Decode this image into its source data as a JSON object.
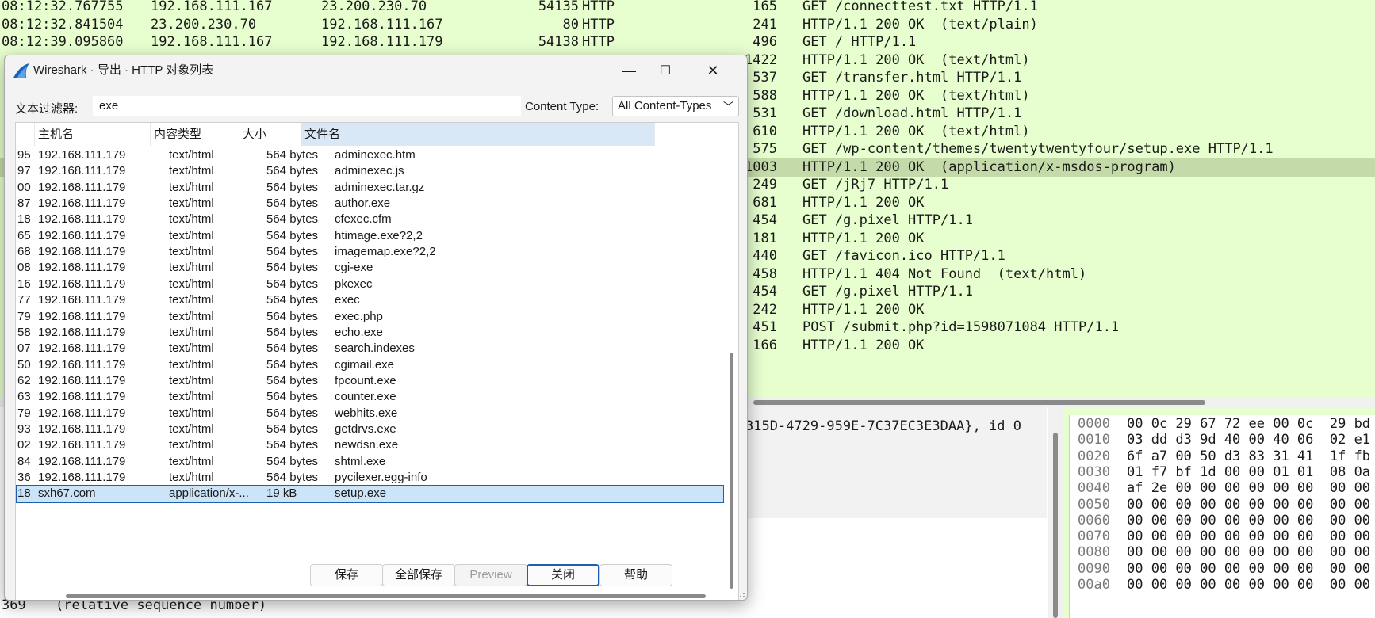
{
  "main_window": {
    "packets": [
      {
        "time": "08:12:32.767755",
        "src": "192.168.111.167",
        "dst": "23.200.230.70",
        "sport": "54135",
        "proto": "HTTP",
        "len": "165",
        "info": "GET /connecttest.txt HTTP/1.1"
      },
      {
        "time": "08:12:32.841504",
        "src": "23.200.230.70",
        "dst": "192.168.111.167",
        "sport": "80",
        "proto": "HTTP",
        "len": "241",
        "info": "HTTP/1.1 200 OK  (text/plain)"
      },
      {
        "time": "08:12:39.095860",
        "src": "192.168.111.167",
        "dst": "192.168.111.179",
        "sport": "54138",
        "proto": "HTTP",
        "len": "496",
        "info": "GET / HTTP/1.1"
      },
      {
        "time": "",
        "src": "",
        "dst": "",
        "sport": "",
        "proto": "",
        "len": "1422",
        "info": "HTTP/1.1 200 OK  (text/html)"
      },
      {
        "time": "",
        "src": "",
        "dst": "",
        "sport": "",
        "proto": "",
        "len": "537",
        "info": "GET /transfer.html HTTP/1.1"
      },
      {
        "time": "",
        "src": "",
        "dst": "",
        "sport": "",
        "proto": "",
        "len": "588",
        "info": "HTTP/1.1 200 OK  (text/html)"
      },
      {
        "time": "",
        "src": "",
        "dst": "",
        "sport": "",
        "proto": "",
        "len": "531",
        "info": "GET /download.html HTTP/1.1"
      },
      {
        "time": "",
        "src": "",
        "dst": "",
        "sport": "",
        "proto": "",
        "len": "610",
        "info": "HTTP/1.1 200 OK  (text/html)"
      },
      {
        "time": "",
        "src": "",
        "dst": "",
        "sport": "",
        "proto": "",
        "len": "575",
        "info": "GET /wp-content/themes/twentytwentyfour/setup.exe HTTP/1.1"
      },
      {
        "time": "",
        "src": "",
        "dst": "",
        "sport": "",
        "proto": "",
        "len": "1003",
        "info": "HTTP/1.1 200 OK  (application/x-msdos-program)"
      },
      {
        "time": "",
        "src": "",
        "dst": "",
        "sport": "",
        "proto": "",
        "len": "249",
        "info": "GET /jRj7 HTTP/1.1"
      },
      {
        "time": "",
        "src": "",
        "dst": "",
        "sport": "",
        "proto": "",
        "len": "681",
        "info": "HTTP/1.1 200 OK"
      },
      {
        "time": "",
        "src": "",
        "dst": "",
        "sport": "",
        "proto": "",
        "len": "454",
        "info": "GET /g.pixel HTTP/1.1"
      },
      {
        "time": "",
        "src": "",
        "dst": "",
        "sport": "",
        "proto": "",
        "len": "181",
        "info": "HTTP/1.1 200 OK"
      },
      {
        "time": "",
        "src": "",
        "dst": "",
        "sport": "",
        "proto": "",
        "len": "440",
        "info": "GET /favicon.ico HTTP/1.1"
      },
      {
        "time": "",
        "src": "",
        "dst": "",
        "sport": "",
        "proto": "",
        "len": "458",
        "info": "HTTP/1.1 404 Not Found  (text/html)"
      },
      {
        "time": "",
        "src": "",
        "dst": "",
        "sport": "",
        "proto": "",
        "len": "454",
        "info": "GET /g.pixel HTTP/1.1"
      },
      {
        "time": "",
        "src": "",
        "dst": "",
        "sport": "",
        "proto": "",
        "len": "242",
        "info": "HTTP/1.1 200 OK"
      },
      {
        "time": "",
        "src": "",
        "dst": "",
        "sport": "",
        "proto": "",
        "len": "451",
        "info": "POST /submit.php?id=1598071084 HTTP/1.1"
      },
      {
        "time": "",
        "src": "",
        "dst": "",
        "sport": "",
        "proto": "",
        "len": "166",
        "info": "HTTP/1.1 200 OK"
      }
    ],
    "selected_packet_index": 9,
    "detail_line_interface": "315D-4729-959E-7C37EC3E3DAA}, id 0",
    "detail_line_seq_num": "369",
    "detail_line_seq": "(relative sequence number)",
    "hex_rows": [
      {
        "offset": "0000",
        "bytes": "00 0c 29 67 72 ee 00 0c  29 bd"
      },
      {
        "offset": "0010",
        "bytes": "03 dd d3 9d 40 00 40 06  02 e1"
      },
      {
        "offset": "0020",
        "bytes": "6f a7 00 50 d3 83 31 41  1f fb"
      },
      {
        "offset": "0030",
        "bytes": "01 f7 bf 1d 00 00 01 01  08 0a"
      },
      {
        "offset": "0040",
        "bytes": "af 2e 00 00 00 00 00 00  00 00"
      },
      {
        "offset": "0050",
        "bytes": "00 00 00 00 00 00 00 00  00 00"
      },
      {
        "offset": "0060",
        "bytes": "00 00 00 00 00 00 00 00  00 00"
      },
      {
        "offset": "0070",
        "bytes": "00 00 00 00 00 00 00 00  00 00"
      },
      {
        "offset": "0080",
        "bytes": "00 00 00 00 00 00 00 00  00 00"
      },
      {
        "offset": "0090",
        "bytes": "00 00 00 00 00 00 00 00  00 00"
      },
      {
        "offset": "00a0",
        "bytes": "00 00 00 00 00 00 00 00  00 00"
      }
    ],
    "colors": {
      "packet_bg": "#e7ffcf",
      "selected_packet": "#c4dba9"
    }
  },
  "dialog": {
    "title": "Wireshark · 导出 · HTTP 对象列表",
    "window_buttons": {
      "minimize": "—",
      "maximize": "☐",
      "close": "✕"
    },
    "filter_label": "文本过滤器:",
    "filter_value": "exe",
    "content_type_label": "Content Type:",
    "content_type_value": "All Content-Types",
    "columns": [
      "主机名",
      "内容类型",
      "大小",
      "文件名"
    ],
    "rows": [
      {
        "num": "95",
        "host": "192.168.111.179",
        "type": "text/html",
        "size": "564 bytes",
        "file": "adminexec.htm"
      },
      {
        "num": "97",
        "host": "192.168.111.179",
        "type": "text/html",
        "size": "564 bytes",
        "file": "adminexec.js"
      },
      {
        "num": "00",
        "host": "192.168.111.179",
        "type": "text/html",
        "size": "564 bytes",
        "file": "adminexec.tar.gz"
      },
      {
        "num": "87",
        "host": "192.168.111.179",
        "type": "text/html",
        "size": "564 bytes",
        "file": "author.exe"
      },
      {
        "num": "18",
        "host": "192.168.111.179",
        "type": "text/html",
        "size": "564 bytes",
        "file": "cfexec.cfm"
      },
      {
        "num": "65",
        "host": "192.168.111.179",
        "type": "text/html",
        "size": "564 bytes",
        "file": "htimage.exe?2,2"
      },
      {
        "num": "68",
        "host": "192.168.111.179",
        "type": "text/html",
        "size": "564 bytes",
        "file": "imagemap.exe?2,2"
      },
      {
        "num": "08",
        "host": "192.168.111.179",
        "type": "text/html",
        "size": "564 bytes",
        "file": "cgi-exe"
      },
      {
        "num": "16",
        "host": "192.168.111.179",
        "type": "text/html",
        "size": "564 bytes",
        "file": "pkexec"
      },
      {
        "num": "77",
        "host": "192.168.111.179",
        "type": "text/html",
        "size": "564 bytes",
        "file": "exec"
      },
      {
        "num": "79",
        "host": "192.168.111.179",
        "type": "text/html",
        "size": "564 bytes",
        "file": "exec.php"
      },
      {
        "num": "58",
        "host": "192.168.111.179",
        "type": "text/html",
        "size": "564 bytes",
        "file": "echo.exe"
      },
      {
        "num": "07",
        "host": "192.168.111.179",
        "type": "text/html",
        "size": "564 bytes",
        "file": "search.indexes"
      },
      {
        "num": "50",
        "host": "192.168.111.179",
        "type": "text/html",
        "size": "564 bytes",
        "file": "cgimail.exe"
      },
      {
        "num": "62",
        "host": "192.168.111.179",
        "type": "text/html",
        "size": "564 bytes",
        "file": "fpcount.exe"
      },
      {
        "num": "63",
        "host": "192.168.111.179",
        "type": "text/html",
        "size": "564 bytes",
        "file": "counter.exe"
      },
      {
        "num": "79",
        "host": "192.168.111.179",
        "type": "text/html",
        "size": "564 bytes",
        "file": "webhits.exe"
      },
      {
        "num": "93",
        "host": "192.168.111.179",
        "type": "text/html",
        "size": "564 bytes",
        "file": "getdrvs.exe"
      },
      {
        "num": "02",
        "host": "192.168.111.179",
        "type": "text/html",
        "size": "564 bytes",
        "file": "newdsn.exe"
      },
      {
        "num": "84",
        "host": "192.168.111.179",
        "type": "text/html",
        "size": "564 bytes",
        "file": "shtml.exe"
      },
      {
        "num": "36",
        "host": "192.168.111.179",
        "type": "text/html",
        "size": "564 bytes",
        "file": "pycilexer.egg-info"
      },
      {
        "num": "18",
        "host": "sxh67.com",
        "type": "application/x-...",
        "size": "19 kB",
        "file": "setup.exe"
      }
    ],
    "selected_row_index": 21,
    "buttons": {
      "save": "保存",
      "save_all": "全部保存",
      "preview": "Preview",
      "close": "关闭",
      "help": "帮助"
    },
    "colors": {
      "selection": "#cce4f7",
      "selection_border": "#1e5fb3",
      "sorted_header": "#d9e8f6",
      "wireshark_fin": "#1565c0"
    }
  }
}
